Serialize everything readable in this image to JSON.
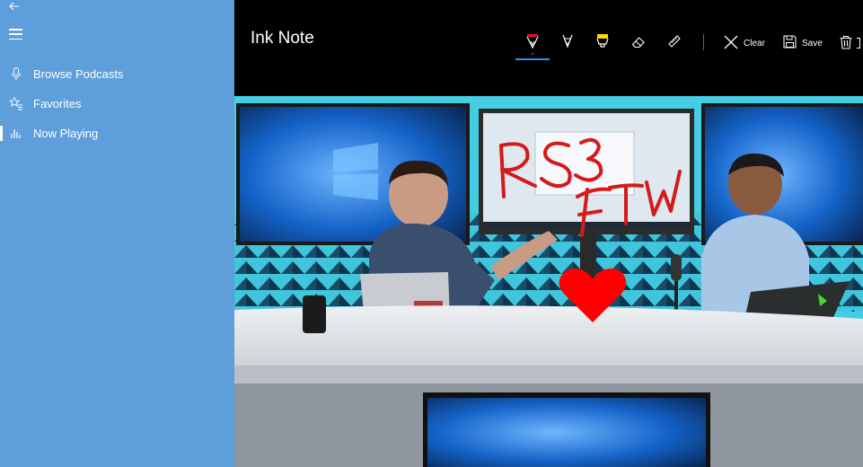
{
  "sidebar": {
    "back_icon": "back-arrow-icon",
    "menu_icon": "hamburger-icon",
    "items": [
      {
        "label": "Browse Podcasts",
        "icon": "microphone-icon"
      },
      {
        "label": "Favorites",
        "icon": "star-list-icon"
      },
      {
        "label": "Now Playing",
        "icon": "equalizer-icon",
        "active": true
      }
    ],
    "color": "#5e9edb"
  },
  "header": {
    "title": "Ink Note"
  },
  "toolbar": {
    "tools": [
      {
        "name": "ballpoint-pen",
        "icon": "ballpoint-pen-icon",
        "ink_color": "#e81123",
        "selected": true
      },
      {
        "name": "pencil",
        "icon": "pencil-icon",
        "selected": false
      },
      {
        "name": "highlighter",
        "icon": "highlighter-icon",
        "ink_color": "#ffd800",
        "selected": false
      },
      {
        "name": "eraser",
        "icon": "eraser-icon",
        "selected": false
      },
      {
        "name": "ruler",
        "icon": "ruler-icon",
        "selected": false
      }
    ],
    "clear_label": "Clear",
    "save_label": "Save",
    "delete_icon": "trash-icon",
    "accent": "#3a8ee6"
  },
  "video": {
    "ink_text_1": "RS3",
    "ink_text_2": "FTW",
    "ink_color": "#d41a1a",
    "heart_color": "#ff0000"
  }
}
